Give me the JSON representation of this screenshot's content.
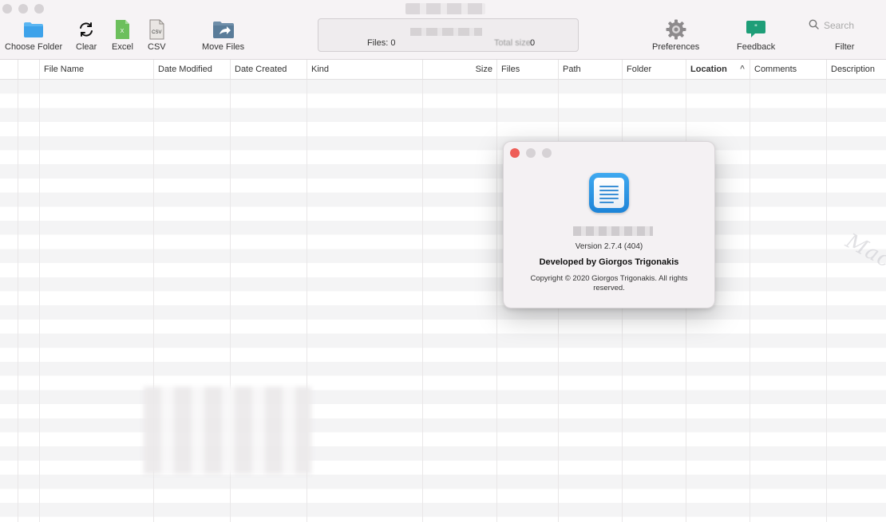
{
  "toolbar": {
    "choose_folder": "Choose Folder",
    "clear": "Clear",
    "excel": "Excel",
    "csv": "CSV",
    "csv_icon_text": "CSV",
    "move_files": "Move Files",
    "preferences": "Preferences",
    "feedback": "Feedback",
    "filter": "Filter",
    "search_placeholder": "Search"
  },
  "status": {
    "files": "Files: 0",
    "size_label": "Total size:",
    "size_value": "0"
  },
  "table": {
    "columns": [
      "File Name",
      "Date Modified",
      "Date Created",
      "Kind",
      "Size",
      "Files",
      "Path",
      "Folder",
      "Location",
      "Comments",
      "Description"
    ],
    "sorted_column": "Location",
    "sort_direction": "ascending",
    "rows": []
  },
  "watermark": "Mac",
  "about": {
    "version": "Version 2.7.4 (404)",
    "developer": "Developed by Giorgos Trigonakis",
    "copyright": "Copyright © 2020 Giorgos Trigonakis. All rights reserved."
  },
  "colors": {
    "accent_blue": "#1d84d8",
    "close_button": "#ee5d57",
    "feedback_green": "#1e9e78",
    "excel_green": "#6cbf5c"
  },
  "icons": {
    "choose_folder": "folder-icon",
    "clear": "refresh-icon",
    "excel": "excel-doc-icon",
    "csv": "csv-doc-icon",
    "move_files": "move-folder-icon",
    "preferences": "gear-icon",
    "feedback": "speech-bubble-icon",
    "search": "magnifier-icon"
  }
}
